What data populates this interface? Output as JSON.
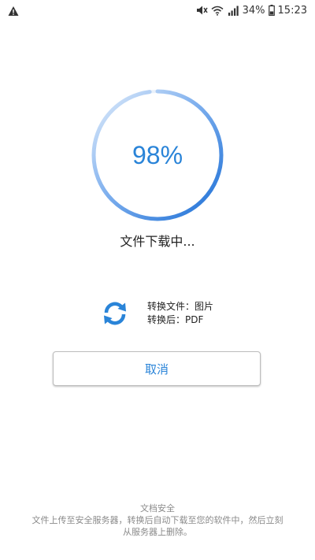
{
  "status_bar": {
    "battery": "34%",
    "time": "15:23",
    "icons": [
      "warning-icon",
      "mute-icon",
      "wifi-icon",
      "signal-icon",
      "battery-icon"
    ]
  },
  "progress": {
    "percent_text": "98%",
    "value": 0.98,
    "status_text": "文件下载中..."
  },
  "conversion": {
    "icon": "sync-icon",
    "from_line": "转换文件：图片",
    "to_line": "转换后：PDF"
  },
  "actions": {
    "cancel_label": "取消"
  },
  "security": {
    "title": "文档安全",
    "description": "文件上传至安全服务器，转换后自动下载至您的软件中，然后立刻从服务器上删除。"
  },
  "colors": {
    "accent": "#2a84d8",
    "ring_track": "#e3eefb",
    "muted_text": "#8a8a8a"
  }
}
